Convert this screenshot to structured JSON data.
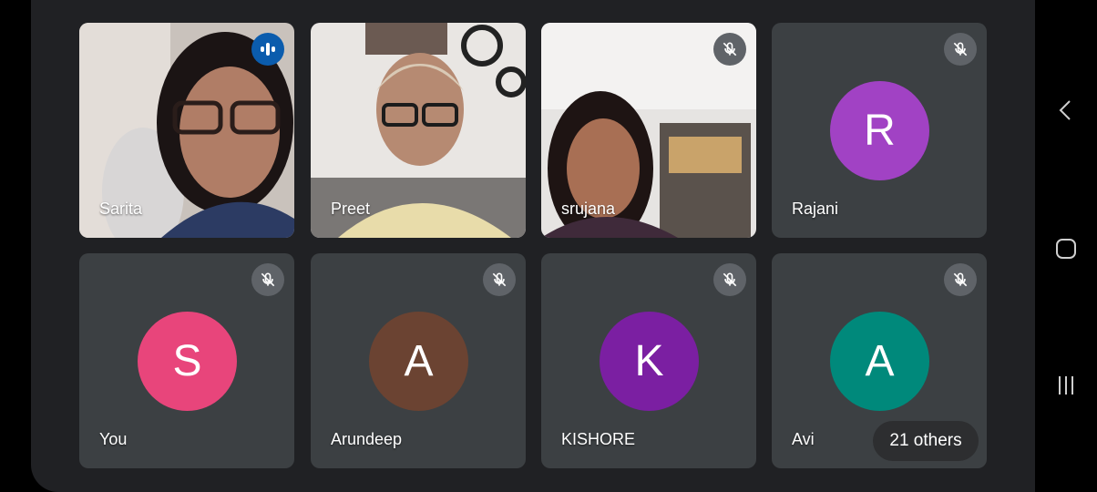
{
  "participants": [
    {
      "name": "Sarita",
      "status": "speaking",
      "video": true
    },
    {
      "name": "Preet",
      "status": "unmuted",
      "video": true
    },
    {
      "name": "srujana",
      "status": "muted",
      "video": true
    },
    {
      "name": "Rajani",
      "initial": "R",
      "avatar_color": "#a142c4",
      "status": "muted",
      "video": false
    },
    {
      "name": "You",
      "initial": "S",
      "avatar_color": "#e8457b",
      "status": "muted",
      "video": false
    },
    {
      "name": "Arundeep",
      "initial": "A",
      "avatar_color": "#6b4332",
      "status": "muted",
      "video": false
    },
    {
      "name": "KISHORE",
      "initial": "K",
      "avatar_color": "#7b1fa2",
      "status": "muted",
      "video": false
    },
    {
      "name": "Avi",
      "initial": "A",
      "avatar_color": "#00897b",
      "status": "muted",
      "video": false
    }
  ],
  "others_label": "21 others",
  "icons": {
    "speaking": "audio-level-icon",
    "muted": "mic-off-icon",
    "nav_back": "chevron-left-icon",
    "nav_home": "home-square-icon",
    "nav_recents": "recents-bars-icon"
  }
}
